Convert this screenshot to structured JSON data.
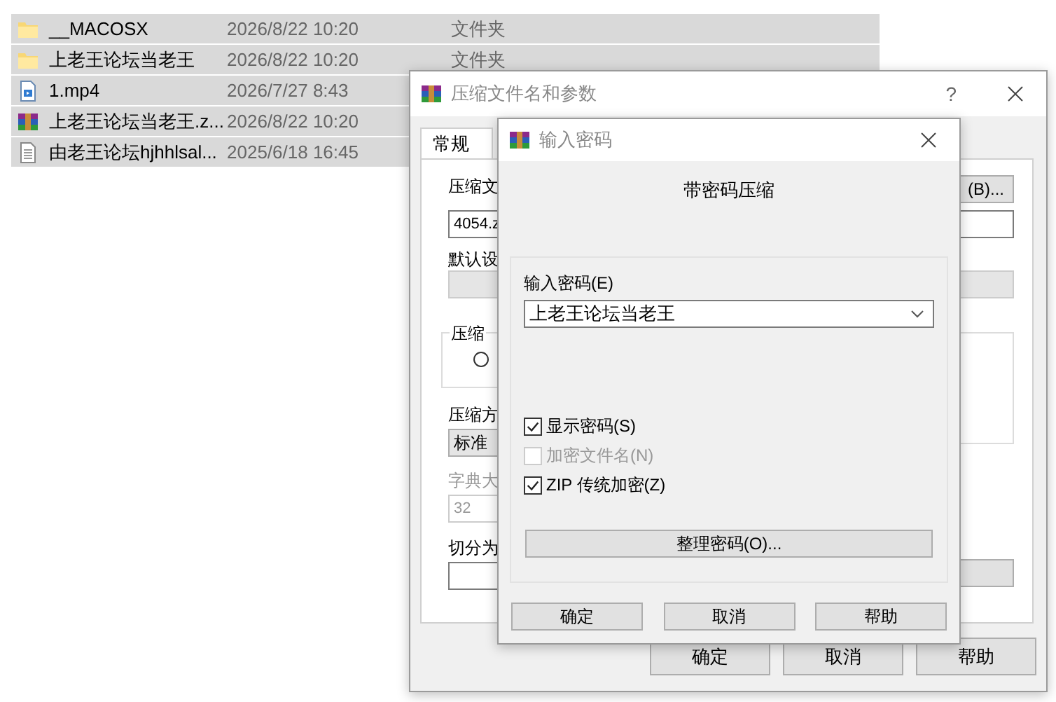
{
  "files": [
    {
      "kind": "folder",
      "name": "__MACOSX",
      "date": "2026/8/22 10:20",
      "type": "文件夹",
      "selected": true
    },
    {
      "kind": "folder",
      "name": "上老王论坛当老王",
      "date": "2026/8/22 10:20",
      "type": "文件夹",
      "selected": true
    },
    {
      "kind": "video",
      "name": "1.mp4",
      "date": "2026/7/27 8:43",
      "selected": true
    },
    {
      "kind": "archive",
      "name": "上老王论坛当老王.z...",
      "date": "2026/8/22 10:20",
      "selected": true
    },
    {
      "kind": "text",
      "name": "由老王论坛hjhhlsal...",
      "date": "2025/6/18 16:45",
      "selected": true
    }
  ],
  "archive_dialog": {
    "title": "压缩文件名和参数",
    "help": "?",
    "tabs": [
      {
        "label": "常规",
        "selected": true
      }
    ],
    "archive_name": {
      "label": "压缩文",
      "value": "4054.z",
      "button": "(B)..."
    },
    "profile": {
      "label": "默认设",
      "disabled": true
    },
    "format_group": {
      "label": "压缩",
      "radio_selected": false
    },
    "method": {
      "label": "压缩方",
      "value": "标准"
    },
    "dictionary": {
      "label": "字典大",
      "value": "32",
      "disabled": true
    },
    "split": {
      "label": "切分为"
    },
    "buttons": [
      "确定",
      "取消",
      "帮助"
    ]
  },
  "password_dialog": {
    "title": "输入密码",
    "heading": "带密码压缩",
    "password": {
      "label": "输入密码(E)",
      "value": "上老王论坛当老王"
    },
    "checkboxes": [
      {
        "label": "显示密码(S)",
        "checked": true,
        "disabled": false
      },
      {
        "label": "加密文件名(N)",
        "checked": false,
        "disabled": true
      },
      {
        "label": "ZIP 传统加密(Z)",
        "checked": true,
        "disabled": false
      }
    ],
    "manage_button": "整理密码(O)...",
    "buttons": [
      "确定",
      "取消",
      "帮助"
    ]
  }
}
